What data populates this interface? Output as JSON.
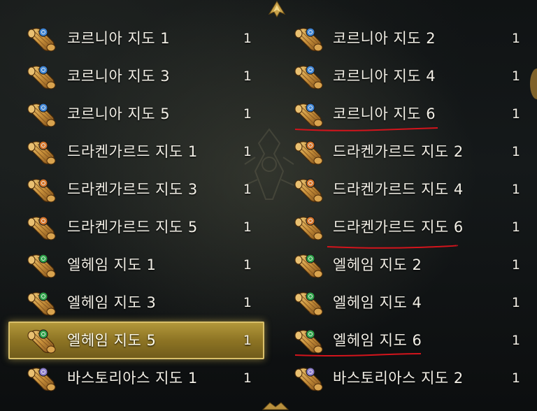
{
  "inventory": {
    "left_column": [
      {
        "name": "코르니아 지도 1",
        "count": "1",
        "seal": "blue"
      },
      {
        "name": "코르니아 지도 3",
        "count": "1",
        "seal": "blue"
      },
      {
        "name": "코르니아 지도 5",
        "count": "1",
        "seal": "blue"
      },
      {
        "name": "드라켄가르드 지도 1",
        "count": "1",
        "seal": "orange"
      },
      {
        "name": "드라켄가르드 지도 3",
        "count": "1",
        "seal": "orange"
      },
      {
        "name": "드라켄가르드 지도 5",
        "count": "1",
        "seal": "orange"
      },
      {
        "name": "엘헤임 지도 1",
        "count": "1",
        "seal": "green"
      },
      {
        "name": "엘헤임 지도 3",
        "count": "1",
        "seal": "green"
      },
      {
        "name": "엘헤임 지도 5",
        "count": "1",
        "seal": "green"
      },
      {
        "name": "바스토리아스 지도 1",
        "count": "1",
        "seal": "purple"
      }
    ],
    "right_column": [
      {
        "name": "코르니아 지도 2",
        "count": "1",
        "seal": "blue"
      },
      {
        "name": "코르니아 지도 4",
        "count": "1",
        "seal": "blue"
      },
      {
        "name": "코르니아 지도 6",
        "count": "1",
        "seal": "blue"
      },
      {
        "name": "드라켄가르드 지도 2",
        "count": "1",
        "seal": "orange"
      },
      {
        "name": "드라켄가르드 지도 4",
        "count": "1",
        "seal": "orange"
      },
      {
        "name": "드라켄가르드 지도 6",
        "count": "1",
        "seal": "orange"
      },
      {
        "name": "엘헤임 지도 2",
        "count": "1",
        "seal": "green"
      },
      {
        "name": "엘헤임 지도 4",
        "count": "1",
        "seal": "green"
      },
      {
        "name": "엘헤임 지도 6",
        "count": "1",
        "seal": "green"
      },
      {
        "name": "바스토리아스 지도 2",
        "count": "1",
        "seal": "purple"
      }
    ],
    "selected_item": "엘헤임 지도 5",
    "highlighted_items": [
      "코르니아 지도 6",
      "드라켄가르드 지도 6",
      "엘헤임 지도 6"
    ]
  },
  "colors": {
    "seal_blue": "#3f86d6",
    "seal_orange": "#d8762a",
    "seal_green": "#2fa64a",
    "seal_purple": "#8e7fd0",
    "selection": "#a88a30",
    "underline": "#d3141c",
    "text": "#f2efe6"
  },
  "icons": {
    "item": "rolled-map-scroll-icon",
    "scroll_up": "chevron-up-ornament-icon",
    "scroll_down": "chevron-down-ornament-icon"
  }
}
